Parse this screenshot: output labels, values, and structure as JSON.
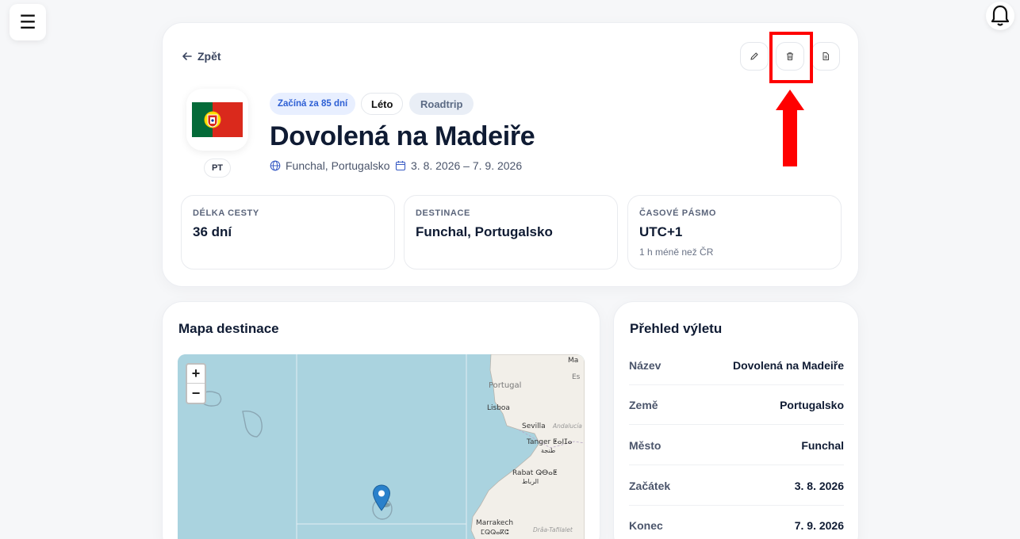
{
  "hero": {
    "back_label": "Zpět",
    "flag_code": "PT",
    "tags": [
      "Začíná za 85 dní",
      "Léto",
      "Roadtrip"
    ],
    "title": "Dovolená na Madeiře",
    "location": "Funchal, Portugalsko",
    "dates": "3. 8. 2026 – 7. 9. 2026"
  },
  "stats": [
    {
      "label": "DÉLKA CESTY",
      "value": "36 dní",
      "sub": ""
    },
    {
      "label": "DESTINACE",
      "value": "Funchal, Portugalsko",
      "sub": ""
    },
    {
      "label": "ČASOVÉ PÁSMO",
      "value": "UTC+1",
      "sub": "1 h méně než ČR"
    }
  ],
  "map": {
    "title": "Mapa destinace",
    "zoom_in": "+",
    "zoom_out": "−",
    "labels": {
      "portugal": "Portugal",
      "lisboa": "Lisboa",
      "sevilla": "Sevilla",
      "andalucia": "Andalucía",
      "tanger": "Tanger ⵟⴰⵏⵊⴰ",
      "tanger_ar": "طنجة",
      "rabat": "Rabat ⵕⴱⴰⵟ",
      "rabat_ar": "الرباط",
      "marrakech": "Marrakech",
      "marrakech_tf": "ⵎⵕⵕⴰⴽⵛ",
      "draa": "Drâa-Tafilalet",
      "ma": "Ma",
      "es": "Es"
    }
  },
  "summary": {
    "title": "Přehled výletu",
    "rows": [
      {
        "label": "Název",
        "value": "Dovolená na Madeiře"
      },
      {
        "label": "Země",
        "value": "Portugalsko"
      },
      {
        "label": "Město",
        "value": "Funchal"
      },
      {
        "label": "Začátek",
        "value": "3. 8. 2026"
      },
      {
        "label": "Konec",
        "value": "7. 9. 2026"
      }
    ]
  },
  "colors": {
    "accent_blue": "#2d5fd4",
    "highlight_red": "#ff0000",
    "map_sea": "#aad3df",
    "map_land": "#f2efe9"
  },
  "icons": [
    "menu-icon",
    "bell-icon",
    "arrow-left-icon",
    "pencil-icon",
    "trash-icon",
    "document-icon",
    "globe-icon",
    "calendar-icon",
    "map-pin-icon"
  ]
}
